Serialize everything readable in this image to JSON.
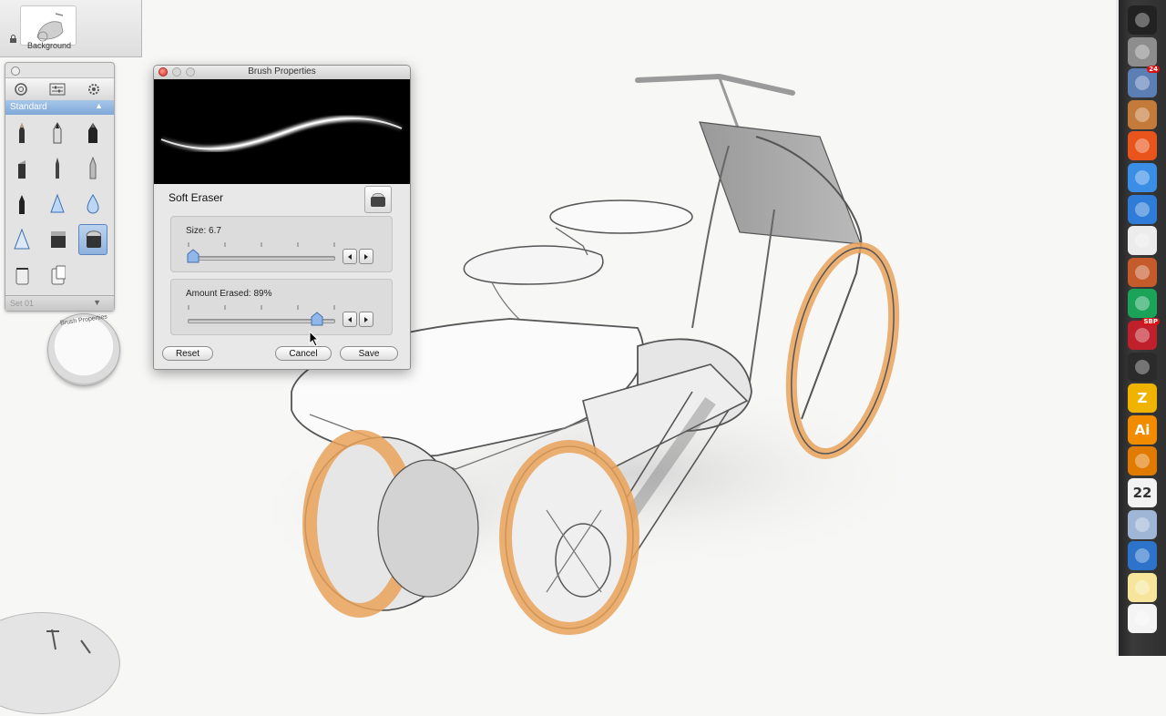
{
  "layer": {
    "name": "Background"
  },
  "palette": {
    "set_name": "Standard",
    "footer_set": "Set 01",
    "brushes": [
      "pencil-brush",
      "marker-brush",
      "ink-marker-brush",
      "chisel-marker-brush",
      "ballpoint-brush",
      "fine-pen-brush",
      "felt-pen-brush",
      "hard-eraser-brush",
      "soft-drop-brush",
      "triangle-brush",
      "solid-eraser-brush",
      "soft-eraser-brush",
      "paint-bucket-brush",
      "gradient-bucket-brush"
    ],
    "selected_brush": "soft-eraser-brush",
    "puck_label": "Brush Properties"
  },
  "dialog": {
    "title": "Brush Properties",
    "brush_name": "Soft Eraser",
    "size_label": "Size: 6.7",
    "size_value": 0.04,
    "erase_label": "Amount Erased: 89%",
    "erase_value": 0.89,
    "buttons": {
      "reset": "Reset",
      "cancel": "Cancel",
      "save": "Save"
    }
  },
  "dock": {
    "apps": [
      {
        "name": "dashboard-icon",
        "bg": "#222"
      },
      {
        "name": "system-preferences-icon",
        "bg": "#8d8d8d"
      },
      {
        "name": "mail-icon",
        "bg": "#5b7fb5",
        "badge": "24"
      },
      {
        "name": "address-book-icon",
        "bg": "#c47a3a"
      },
      {
        "name": "firefox-icon",
        "bg": "#e8541b"
      },
      {
        "name": "ichat-icon",
        "bg": "#3a8ee6"
      },
      {
        "name": "itunes-icon",
        "bg": "#2f7bd8"
      },
      {
        "name": "textedit-icon",
        "bg": "#ececec"
      },
      {
        "name": "iphoto-icon",
        "bg": "#c55a2b"
      },
      {
        "name": "sketchbook-icon",
        "bg": "#1ba35a"
      },
      {
        "name": "sketchbook-pro-icon",
        "bg": "#c0202c",
        "badge": "SBP"
      },
      {
        "name": "inkscape-icon",
        "bg": "#2b2b2b"
      },
      {
        "name": "zend-icon",
        "bg": "#f0b400",
        "text": "Z"
      },
      {
        "name": "illustrator-icon",
        "bg": "#f28b00",
        "text": "Ai"
      },
      {
        "name": "burn-icon",
        "bg": "#e07b00"
      },
      {
        "name": "ical-icon",
        "bg": "#f2f2f2",
        "text": "22"
      },
      {
        "name": "preview-icon",
        "bg": "#9fb6d6"
      },
      {
        "name": "safari-icon",
        "bg": "#2d73c9"
      },
      {
        "name": "notes-icon",
        "bg": "#f6e59a"
      },
      {
        "name": "document-icon",
        "bg": "#f4f4f4"
      }
    ]
  },
  "colors": {
    "accent_orange": "#e9a25a",
    "selection_blue": "#7fa8d8",
    "preview_bg": "#000000"
  }
}
